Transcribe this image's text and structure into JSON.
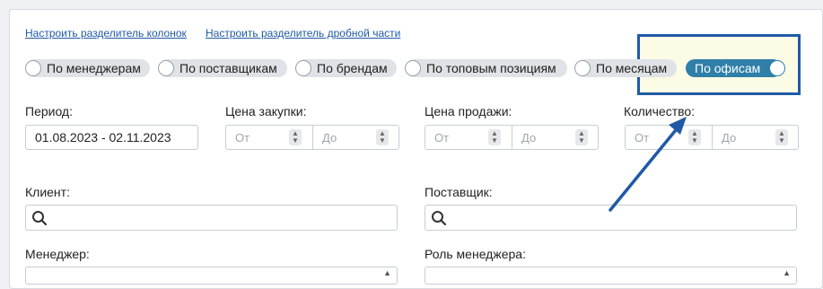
{
  "links": {
    "column_separator": "Настроить разделитель колонок",
    "decimal_separator": "Настроить разделитель дробной части"
  },
  "grouping": [
    {
      "label": "По менеджерам",
      "selected": false
    },
    {
      "label": "По поставщикам",
      "selected": false
    },
    {
      "label": "По брендам",
      "selected": false
    },
    {
      "label": "По топовым позициям",
      "selected": false
    },
    {
      "label": "По месяцам",
      "selected": false
    },
    {
      "label": "По офисам",
      "selected": true
    }
  ],
  "filters": {
    "period_label": "Период:",
    "period_value": "01.08.2023 - 02.11.2023",
    "purchase_price_label": "Цена закупки:",
    "sale_price_label": "Цена продажи:",
    "quantity_label": "Количество:",
    "from_placeholder": "От",
    "to_placeholder": "До",
    "client_label": "Клиент:",
    "supplier_label": "Поставщик:",
    "manager_label": "Менеджер:",
    "manager_role_label": "Роль менеджера:"
  },
  "colors": {
    "accent": "#2f7fa8",
    "annotation": "#1f5aa6",
    "highlight_fill": "#fcfbe6"
  }
}
